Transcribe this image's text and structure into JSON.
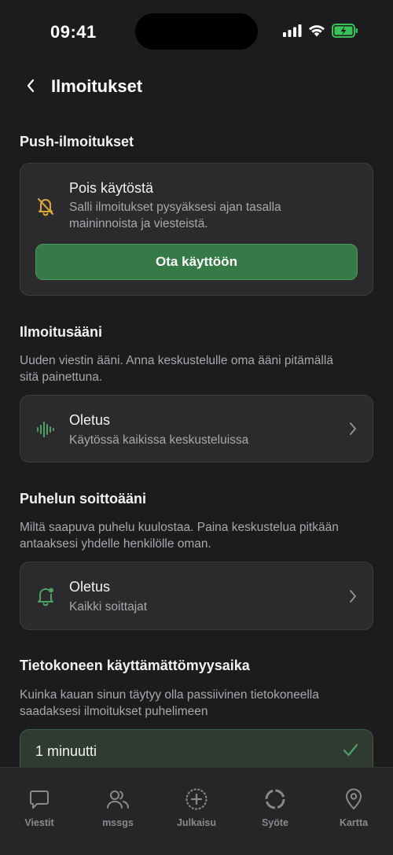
{
  "status_bar": {
    "time": "09:41"
  },
  "header": {
    "title": "Ilmoitukset"
  },
  "push": {
    "section_title": "Push-ilmoitukset",
    "status_title": "Pois käytöstä",
    "status_desc_line1": "Salli ilmoitukset pysyäksesi ajan tasalla",
    "status_desc_line2": "maininnoista ja viesteistä.",
    "enable_label": "Ota käyttöön"
  },
  "notification_sound": {
    "section_title": "Ilmoitusääni",
    "desc_line1": "Uuden viestin ääni. Anna keskustelulle oma ääni pitämällä",
    "desc_line2": "sitä painettuna.",
    "value_title": "Oletus",
    "value_sub": "Käytössä kaikissa keskusteluissa"
  },
  "ringtone": {
    "section_title": "Puhelun soittoääni",
    "desc_line1": "Miltä saapuva puhelu kuulostaa. Paina keskustelua pitkään",
    "desc_line2": "antaaksesi yhdelle henkilölle oman.",
    "value_title": "Oletus",
    "value_sub": "Kaikki soittajat"
  },
  "idle": {
    "section_title": "Tietokoneen käyttämättömyysaika",
    "desc_line1": "Kuinka kauan sinun täytyy olla passiivinen tietokoneella",
    "desc_line2": "saadaksesi ilmoitukset puhelimeen",
    "selected_option": "1 minuutti"
  },
  "tabs": [
    {
      "label": "Viestit",
      "icon": "chat-bubble-icon"
    },
    {
      "label": "mssgs",
      "icon": "people-icon"
    },
    {
      "label": "Julkaisu",
      "icon": "plus-circle-icon"
    },
    {
      "label": "Syöte",
      "icon": "feed-circle-icon"
    },
    {
      "label": "Kartta",
      "icon": "map-pin-icon"
    }
  ],
  "colors": {
    "background": "#1c1c1e",
    "card": "#2b2b2d",
    "accent_green": "#357a47",
    "icon_yellow": "#d9a93a",
    "icon_green": "#4fa064"
  }
}
